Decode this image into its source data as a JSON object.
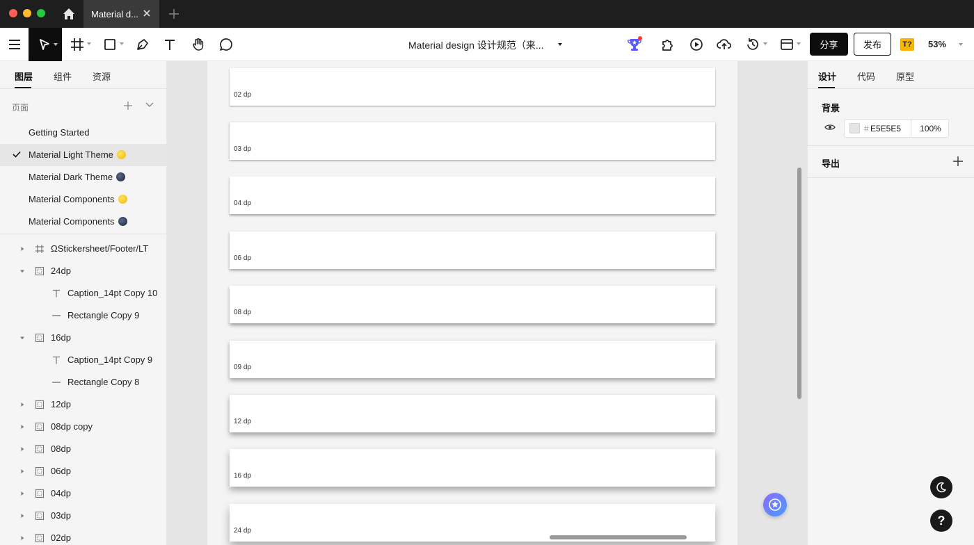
{
  "window": {
    "tab_title": "Material d..."
  },
  "toolbar": {
    "doc_title": "Material design 设计规范（来...",
    "share_label": "分享",
    "publish_label": "发布",
    "font_badge": "T?",
    "zoom": "53%"
  },
  "left_panel": {
    "tabs": [
      "图层",
      "组件",
      "资源"
    ],
    "pages_label": "页面",
    "pages": [
      {
        "label": "Getting Started",
        "emoji": "",
        "selected": false
      },
      {
        "label": "Material Light Theme",
        "emoji": "sun",
        "selected": true
      },
      {
        "label": "Material Dark Theme",
        "emoji": "moon",
        "selected": false
      },
      {
        "label": "Material Components",
        "emoji": "sun",
        "selected": false
      },
      {
        "label": "Material Components",
        "emoji": "moon",
        "selected": false
      }
    ],
    "layers": [
      {
        "label": "ΩStickersheet/Footer/LT",
        "type": "frame",
        "expanded": false,
        "depth": 0
      },
      {
        "label": "24dp",
        "type": "group",
        "expanded": true,
        "depth": 0
      },
      {
        "label": "Caption_14pt Copy 10",
        "type": "text",
        "expanded": null,
        "depth": 1
      },
      {
        "label": "Rectangle Copy 9",
        "type": "line",
        "expanded": null,
        "depth": 1
      },
      {
        "label": "16dp",
        "type": "group",
        "expanded": true,
        "depth": 0
      },
      {
        "label": "Caption_14pt Copy 9",
        "type": "text",
        "expanded": null,
        "depth": 1
      },
      {
        "label": "Rectangle Copy 8",
        "type": "line",
        "expanded": null,
        "depth": 1
      },
      {
        "label": "12dp",
        "type": "group",
        "expanded": false,
        "depth": 0
      },
      {
        "label": "08dp copy",
        "type": "group",
        "expanded": false,
        "depth": 0
      },
      {
        "label": "08dp",
        "type": "group",
        "expanded": false,
        "depth": 0
      },
      {
        "label": "06dp",
        "type": "group",
        "expanded": false,
        "depth": 0
      },
      {
        "label": "04dp",
        "type": "group",
        "expanded": false,
        "depth": 0
      },
      {
        "label": "03dp",
        "type": "group",
        "expanded": false,
        "depth": 0
      },
      {
        "label": "02dp",
        "type": "group",
        "expanded": false,
        "depth": 0
      }
    ]
  },
  "canvas": {
    "cards": [
      "02 dp",
      "03 dp",
      "04 dp",
      "06 dp",
      "08 dp",
      "09 dp",
      "12 dp",
      "16 dp",
      "24 dp"
    ]
  },
  "right_panel": {
    "tabs": [
      "设计",
      "代码",
      "原型"
    ],
    "background_title": "背景",
    "bg_hash": "#",
    "bg_hex": "E5E5E5",
    "bg_opacity": "100%",
    "export_title": "导出",
    "help_label": "?"
  },
  "colors": {
    "accent": "#0d0d0d",
    "canvas_bg": "#E5E5E5",
    "badge": "#f7b500"
  }
}
